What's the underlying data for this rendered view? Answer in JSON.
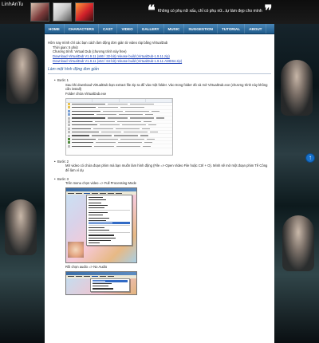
{
  "site": {
    "logo_text": "LinhAnTu",
    "quote": "Không có phụ nữ xấu, chỉ có phụ nữ...tự làm đẹp cho mình",
    "quote_open": "❝",
    "quote_close": "❞"
  },
  "nav": {
    "items": [
      {
        "label": "HOME"
      },
      {
        "label": "CHARACTERS"
      },
      {
        "label": "CAST"
      },
      {
        "label": "VIDEO"
      },
      {
        "label": "GALLERY"
      },
      {
        "label": "MUSIC"
      },
      {
        "label": "SUGGESTION"
      },
      {
        "label": "TUTORIAL"
      },
      {
        "label": "ABOUT"
      }
    ]
  },
  "content": {
    "intro_line": "Hôm nay mình chỉ các bạn cách làm động đơn giản từ video ráp bằng VirtualDub",
    "time_line": "Thời gian: 5 phút",
    "program_line": "Chương trình: Virtual Dub (chương trình này free)",
    "download_links": [
      "Download VirtualDub V1.9.11 (x86 / 32-bit) release build (VirtualDub-1.9.11.zip)",
      "Download VirtualDub V1.9.11 (x64 / 64-bit) release build (VirtualDub-1.9.11-AMD64.zip)"
    ],
    "section_title": "Làm một hình động đơn giản",
    "steps": [
      {
        "title": "Bước 1",
        "text": "Sau khi download VirtualDub bạn extract file zip ra để vào một folder. Vào trong folder đó và mở VirtualDub.exe (chương trình này không cần install)",
        "caption": "Folder chứa VirtualDub.exe"
      },
      {
        "title": "Bước 2",
        "text": "Mở video có chứa đoạn phim mà bạn muốn làm hình động (File => Open Video File hoặc Ctrl + O). Mình sẽ mở một đoạn phim Tề Công để làm ví dụ"
      },
      {
        "title": "Bước 3",
        "text": "Trên menu chọn video => Full Processing Mode",
        "caption2": "Rồi chọn audio => No Audio"
      }
    ]
  },
  "scroll_top": {
    "symbol": "↑"
  }
}
